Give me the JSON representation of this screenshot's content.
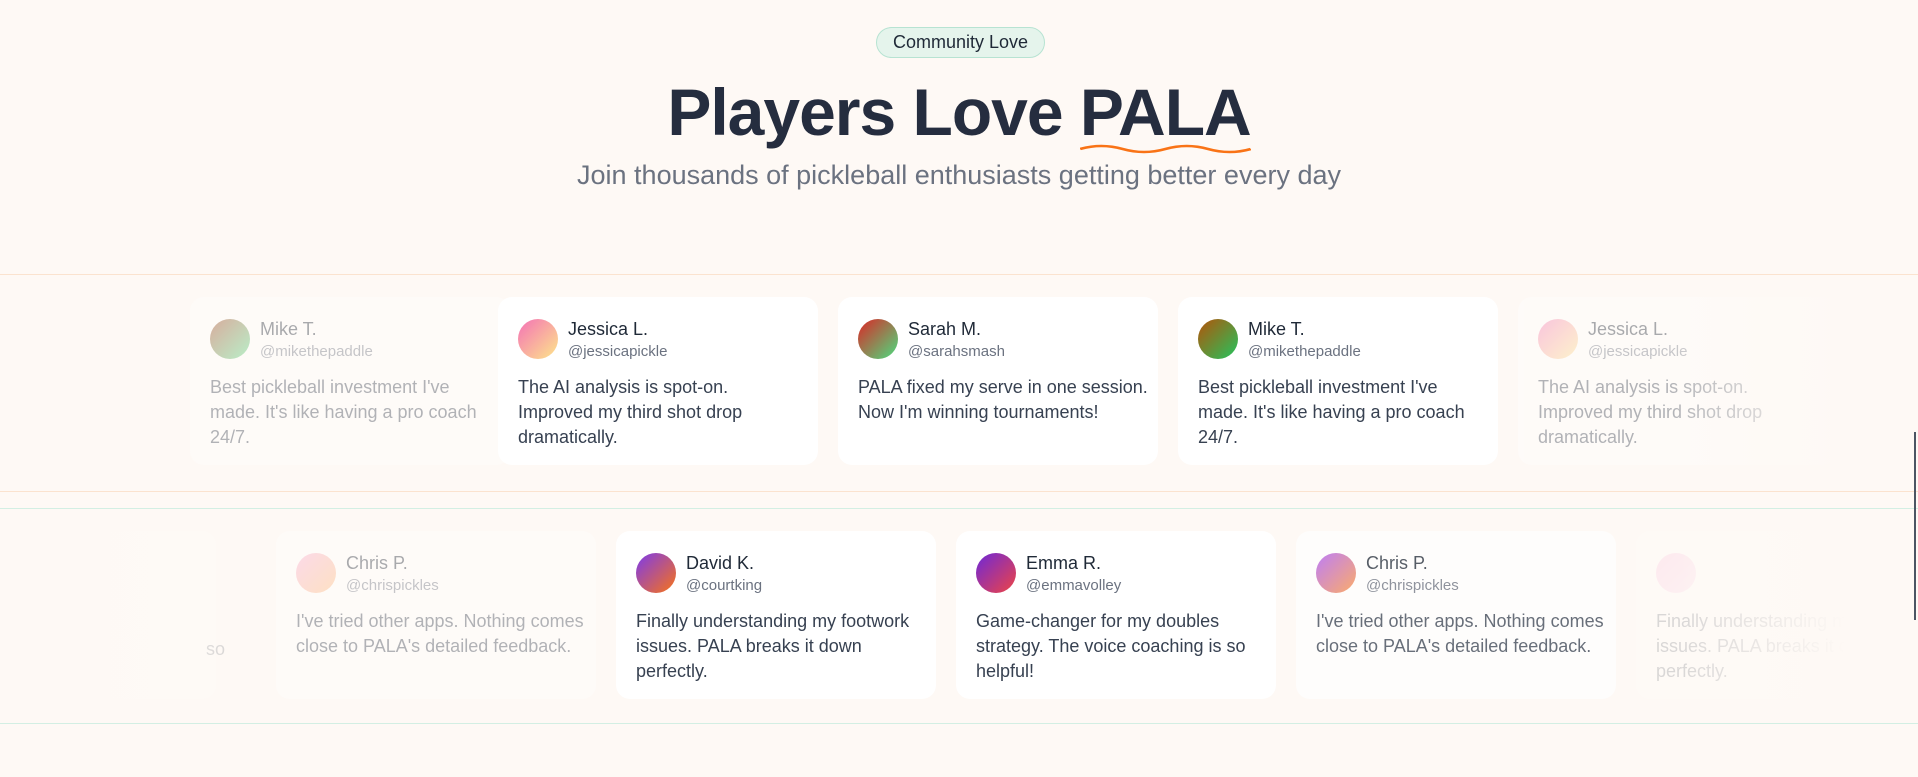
{
  "badge": "Community Love",
  "heading": {
    "prefix": "Players Love ",
    "accent": "PALA"
  },
  "subtitle": "Join thousands of pickleball enthusiasts getting better every day",
  "colors": {
    "accent_underline": "#f97316",
    "badge_bg": "#e5f4ec",
    "page_bg": "#fef9f5"
  },
  "row1": [
    {
      "name": "Mike T.",
      "handle": "@mikethepaddle",
      "quote": "Best pickleball investment I've made. It's like having a pro coach 24/7."
    },
    {
      "name": "Jessica L.",
      "handle": "@jessicapickle",
      "quote": "The AI analysis is spot-on. Improved my third shot drop dramatically."
    },
    {
      "name": "Sarah M.",
      "handle": "@sarahsmash",
      "quote": "PALA fixed my serve in one session. Now I'm winning tournaments!"
    },
    {
      "name": "Mike T.",
      "handle": "@mikethepaddle",
      "quote": "Best pickleball investment I've made. It's like having a pro coach 24/7."
    },
    {
      "name": "Jessica L.",
      "handle": "@jessicapickle",
      "quote": "The AI analysis is spot-on. Improved my third shot drop dramatically."
    }
  ],
  "row2": [
    {
      "name": "",
      "handle": "",
      "quote": "so"
    },
    {
      "name": "Chris P.",
      "handle": "@chrispickles",
      "quote": "I've tried other apps. Nothing comes close to PALA's detailed feedback."
    },
    {
      "name": "David K.",
      "handle": "@courtking",
      "quote": "Finally understanding my footwork issues. PALA breaks it down perfectly."
    },
    {
      "name": "Emma R.",
      "handle": "@emmavolley",
      "quote": "Game-changer for my doubles strategy. The voice coaching is so helpful!"
    },
    {
      "name": "Chris P.",
      "handle": "@chrispickles",
      "quote": "I've tried other apps. Nothing comes close to PALA's detailed feedback."
    },
    {
      "name": "",
      "handle": "",
      "quote": "Finally understanding my footwork issues. PALA breaks it down perfectly."
    }
  ]
}
